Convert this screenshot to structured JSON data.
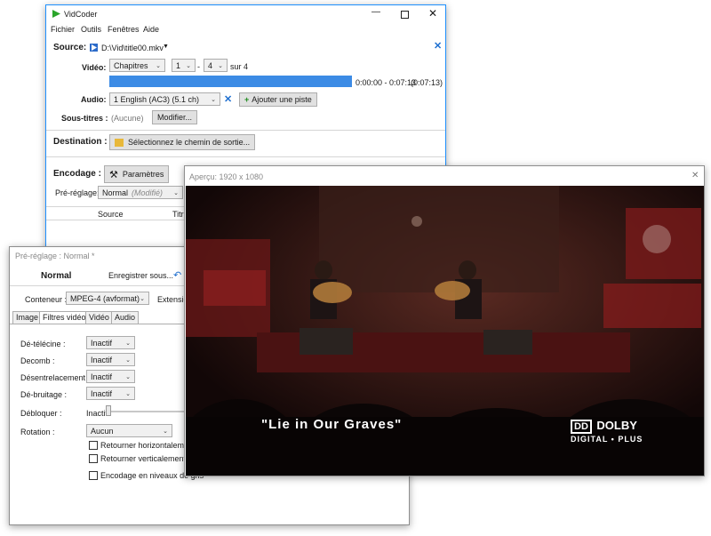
{
  "main": {
    "title": "VidCoder",
    "menu": [
      "Fichier",
      "Outils",
      "Fenêtres",
      "Aide"
    ],
    "source_label": "Source:",
    "source_path": "D:\\Vid\\title00.mkv",
    "video_label": "Vidéo:",
    "range_type": "Chapitres",
    "chapter_start": "1",
    "chapter_end": "4",
    "dash": "-",
    "total": "sur 4",
    "time_range": "0:00:00 - 0:07:13",
    "duration": "(0:07:13)",
    "selection_fraction": 1.0,
    "audio_label": "Audio:",
    "audio_track": "1 English (AC3) (5.1 ch)",
    "add_track_label": "Ajouter une piste",
    "subtitles_label": "Sous-titres :",
    "subtitles_value": "(Aucune)",
    "modify_label": "Modifier...",
    "destination_label": "Destination :",
    "destination_button": "Sélectionnez le chemin de sortie...",
    "encoding_label": "Encodage :",
    "settings_button": "Paramètres",
    "preset_label": "Pré-réglage:",
    "preset_value": "Normal",
    "preset_modified": "(Modifié)",
    "col_source": "Source",
    "col_title_partial": "Titr"
  },
  "preset": {
    "title": "Pré-réglage : Normal *",
    "name": "Normal",
    "save_label": "Enregistrer sous...",
    "container_label": "Conteneur :",
    "container_value": "MPEG-4 (avformat)",
    "extension_partial": "Extensio",
    "tabs": [
      "Image",
      "Filtres vidéo",
      "Vidéo",
      "Audio"
    ],
    "filters": [
      {
        "label": "Dé-télécine :",
        "value": "Inactif"
      },
      {
        "label": "Decomb :",
        "value": "Inactif"
      },
      {
        "label": "Désentrelacement :",
        "value": "Inactif"
      },
      {
        "label": "Dé-bruitage :",
        "value": "Inactif"
      }
    ],
    "deblock_label": "Débloquer :",
    "deblock_value": "Inactif",
    "rotation_label": "Rotation :",
    "rotation_value": "Aucun",
    "flip_h": "Retourner horizontalement",
    "flip_v": "Retourner verticalement",
    "grayscale": "Encodage en niveaux de gris"
  },
  "preview": {
    "title": "Aperçu: 1920 x 1080",
    "subtitle": "\"Lie in Our Graves\"",
    "logo_top": "DOLBY",
    "logo_bottom": "DIGITAL • PLUS"
  },
  "colors": {
    "accent": "#1e90ff",
    "progress": "#3c8be5",
    "stage_red": "#8a1c1c"
  }
}
